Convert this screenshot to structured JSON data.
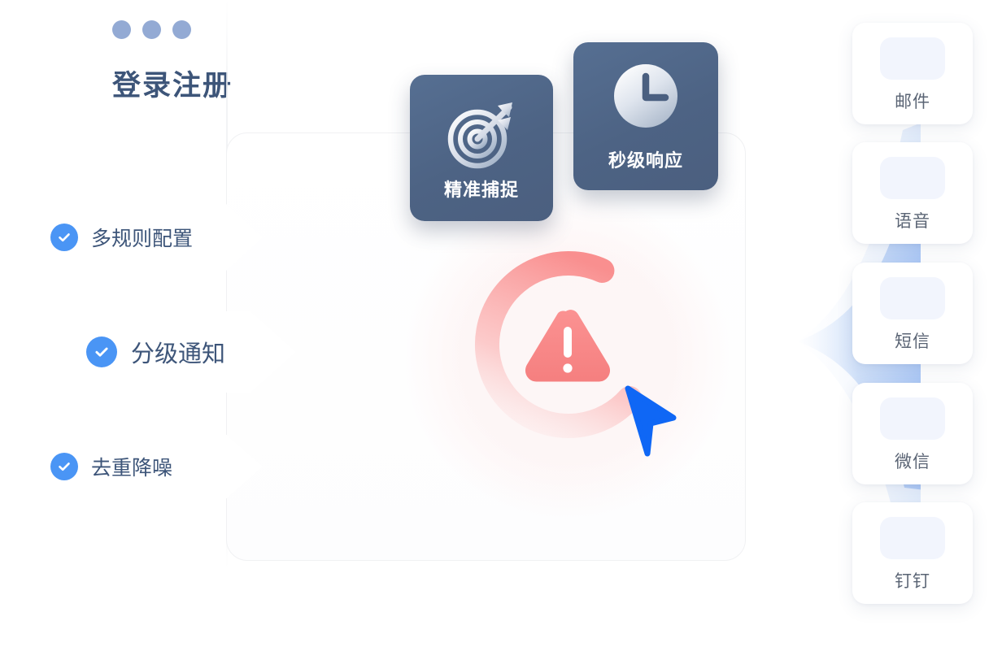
{
  "window": {
    "title": "登录注册",
    "traffic_lights": [
      "dot-1",
      "dot-2",
      "dot-3"
    ],
    "dot_color": "#93aad4",
    "title_color": "#3d5579"
  },
  "feature_cards": [
    {
      "label": "精准捕捉",
      "icon": "target-icon",
      "bg_color": "#4d6384",
      "text_color": "#ffffff"
    },
    {
      "label": "秒级响应",
      "icon": "clock-icon",
      "bg_color": "#4d6384",
      "text_color": "#ffffff"
    }
  ],
  "rule_pills": [
    {
      "label": "多规则配置",
      "icon": "check-circle-icon",
      "accent": "#4a95f5"
    },
    {
      "label": "分级通知",
      "icon": "check-circle-icon",
      "accent": "#4a95f5"
    },
    {
      "label": "去重降噪",
      "icon": "check-circle-icon",
      "accent": "#4a95f5"
    }
  ],
  "center": {
    "alert_icon": "warning-triangle-icon",
    "alert_color": "#f98080",
    "gauge_color": "#f98f8f",
    "cursor_icon": "cursor-arrow-icon",
    "cursor_color": "#0f67f5"
  },
  "channels": [
    {
      "label": "邮件",
      "icon": "mail-icon"
    },
    {
      "label": "语音",
      "icon": "voice-icon"
    },
    {
      "label": "短信",
      "icon": "sms-icon"
    },
    {
      "label": "微信",
      "icon": "wechat-icon"
    },
    {
      "label": "钉钉",
      "icon": "dingtalk-icon"
    }
  ],
  "decor": {
    "beam": "blue-radiating-beam",
    "beam_color": "#a9c6f5"
  }
}
